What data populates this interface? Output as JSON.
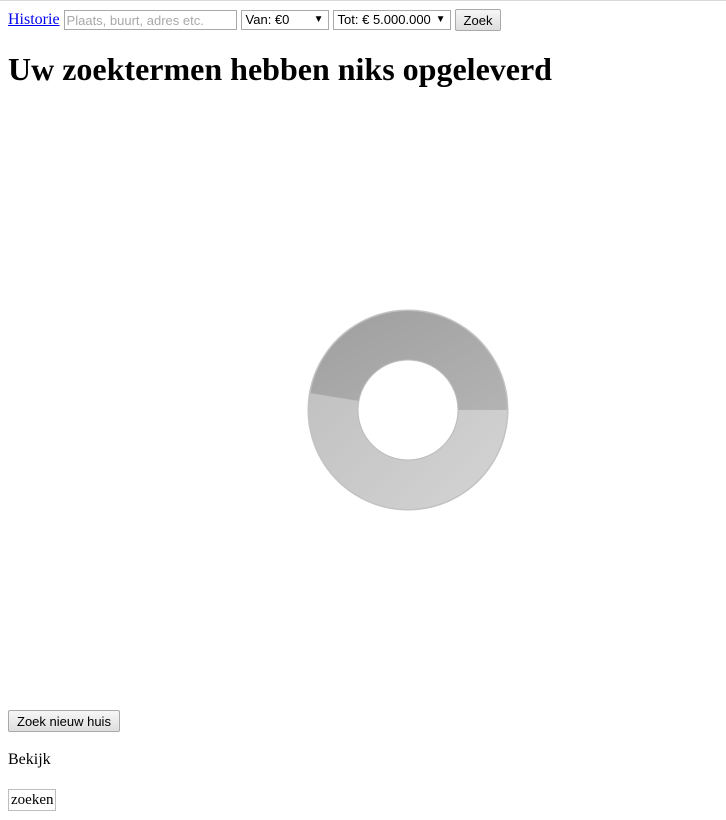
{
  "toolbar": {
    "history_link": "Historie",
    "search_placeholder": "Plaats, buurt, adres etc.",
    "search_value": "",
    "van_select": "Van: €0",
    "tot_select": "Tot: € 5.000.000",
    "zoek_button": "Zoek"
  },
  "main": {
    "title": "Uw zoektermen hebben niks opgeleverd"
  },
  "footer": {
    "new_house_button": "Zoek nieuw huis",
    "bekijk_text": "Bekijk",
    "zoeken_text": "zoeken"
  },
  "icons": {
    "loading": "loading-spinner-icon",
    "dropdown": "chevron-down-icon"
  }
}
